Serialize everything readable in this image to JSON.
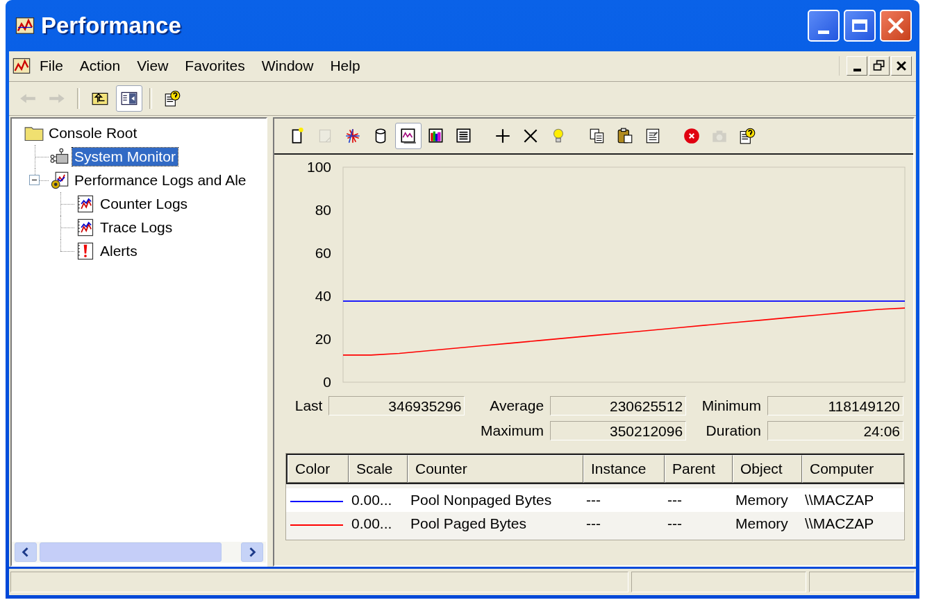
{
  "window": {
    "title": "Performance"
  },
  "menu": [
    {
      "label": "File"
    },
    {
      "label": "Action"
    },
    {
      "label": "View"
    },
    {
      "label": "Favorites"
    },
    {
      "label": "Window"
    },
    {
      "label": "Help"
    }
  ],
  "toolbar": [
    {
      "kind": "back",
      "disabled": true,
      "pressed": false
    },
    {
      "kind": "forward",
      "disabled": true,
      "pressed": false
    },
    {
      "kind": "separator"
    },
    {
      "kind": "up-folder",
      "disabled": false,
      "pressed": false
    },
    {
      "kind": "tree-toggle",
      "disabled": false,
      "pressed": true
    },
    {
      "kind": "separator"
    },
    {
      "kind": "help",
      "disabled": false,
      "pressed": false
    }
  ],
  "tree": {
    "label": "Console Root",
    "kind": "folder",
    "selected": false,
    "children": [
      {
        "label": "System Monitor",
        "kind": "monitor",
        "selected": true
      },
      {
        "label": "Performance Logs and Ale",
        "kind": "logs",
        "selected": false,
        "expanded": true,
        "children": [
          {
            "label": "Counter Logs",
            "kind": "chart-log",
            "selected": false
          },
          {
            "label": "Trace Logs",
            "kind": "chart-log",
            "selected": false
          },
          {
            "label": "Alerts",
            "kind": "alert",
            "selected": false
          }
        ]
      }
    ]
  },
  "monitor_toolbar": [
    {
      "kind": "new-set",
      "disabled": false,
      "pressed": false
    },
    {
      "kind": "clear",
      "disabled": true,
      "pressed": false
    },
    {
      "kind": "current",
      "disabled": false,
      "pressed": false
    },
    {
      "kind": "log",
      "disabled": false,
      "pressed": false
    },
    {
      "kind": "graph",
      "disabled": false,
      "pressed": true
    },
    {
      "kind": "histogram",
      "disabled": false,
      "pressed": false
    },
    {
      "kind": "report",
      "disabled": false,
      "pressed": false
    },
    {
      "kind": "separator"
    },
    {
      "kind": "add",
      "disabled": false,
      "pressed": false
    },
    {
      "kind": "delete",
      "disabled": false,
      "pressed": false
    },
    {
      "kind": "highlight",
      "disabled": false,
      "pressed": false
    },
    {
      "kind": "separator"
    },
    {
      "kind": "copy",
      "disabled": false,
      "pressed": false
    },
    {
      "kind": "paste",
      "disabled": false,
      "pressed": false
    },
    {
      "kind": "properties",
      "disabled": false,
      "pressed": false
    },
    {
      "kind": "separator"
    },
    {
      "kind": "freeze",
      "disabled": false,
      "pressed": false
    },
    {
      "kind": "update",
      "disabled": true,
      "pressed": false
    },
    {
      "kind": "help",
      "disabled": false,
      "pressed": false
    }
  ],
  "graph": {
    "chart_data": {
      "type": "line",
      "ylim": [
        0,
        100
      ],
      "yticks": [
        0,
        20,
        40,
        60,
        80,
        100
      ],
      "series": [
        {
          "color": "#0000ff",
          "values": [
            37.7,
            37.7,
            37.7,
            37.7,
            37.7,
            37.7,
            37.7,
            37.7,
            37.7,
            37.7,
            37.7,
            37.7,
            37.7,
            37.7,
            37.7,
            37.7,
            37.7,
            37.7,
            37.7,
            37.7,
            37.7
          ]
        },
        {
          "color": "#ff0000",
          "values": [
            12.6,
            12.6,
            13.4,
            14.6,
            15.8,
            17,
            18.2,
            19.4,
            20.6,
            21.8,
            23,
            24.2,
            25.4,
            26.6,
            27.8,
            29,
            30.2,
            31.4,
            32.6,
            33.8,
            34.5
          ]
        }
      ]
    }
  },
  "stats": [
    {
      "label": "Last",
      "value": "346935296"
    },
    {
      "label": "Average",
      "value": "230625512"
    },
    {
      "label": "Minimum",
      "value": "118149120"
    },
    {
      "label": "Maximum",
      "value": "350212096"
    },
    {
      "label": "Duration",
      "value": "24:06"
    }
  ],
  "legend": {
    "columns": [
      "Color",
      "Scale",
      "Counter",
      "Instance",
      "Parent",
      "Object",
      "Computer"
    ],
    "rows": [
      {
        "color": "#0000ff",
        "cells": [
          "",
          "0.00...",
          "Pool Nonpaged Bytes",
          "---",
          "---",
          "Memory",
          "\\\\MACZAP"
        ]
      },
      {
        "color": "#ff0000",
        "cells": [
          "",
          "0.00...",
          "Pool Paged Bytes",
          "---",
          "---",
          "Memory",
          "\\\\MACZAP"
        ]
      }
    ]
  }
}
